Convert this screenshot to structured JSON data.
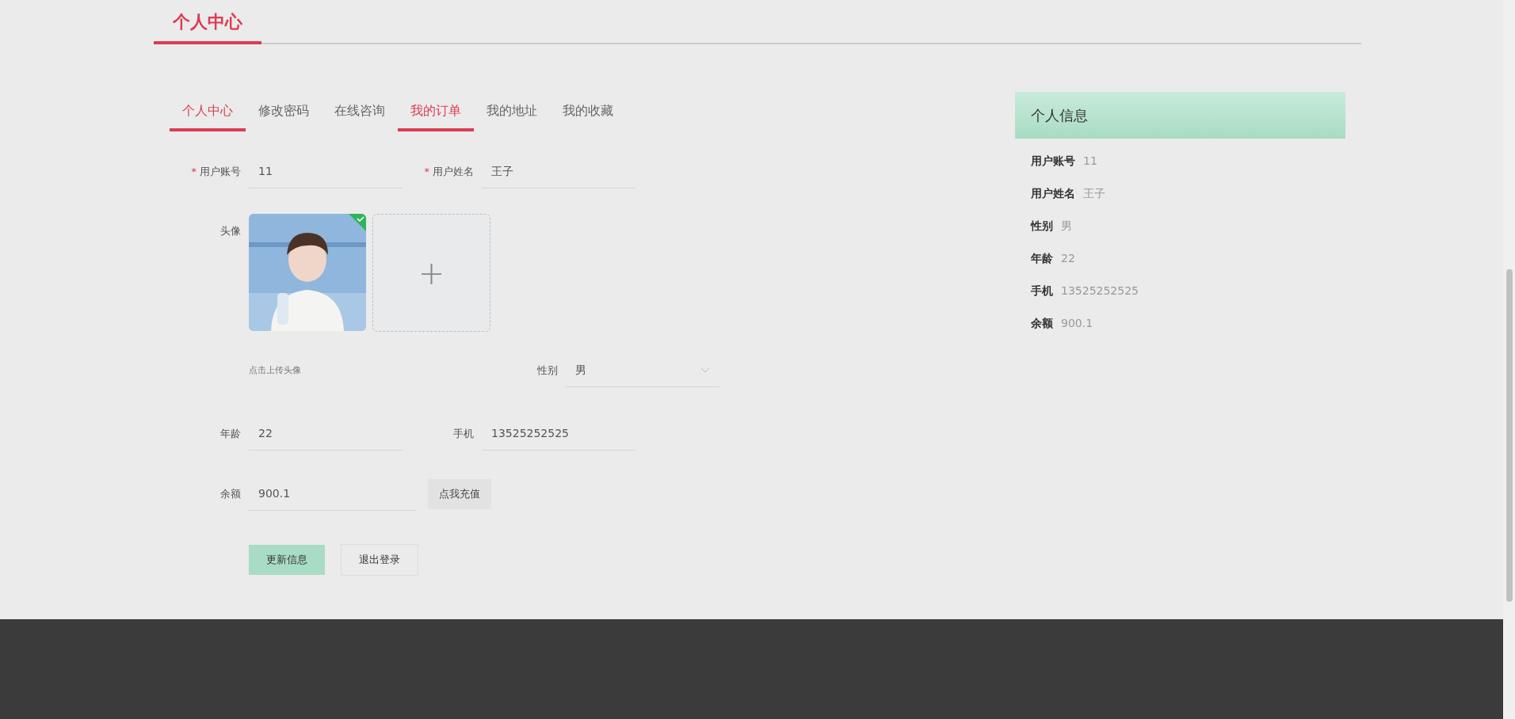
{
  "page_title": "个人中心",
  "tabs": [
    {
      "label": "个人中心",
      "selected": true
    },
    {
      "label": "修改密码",
      "selected": false
    },
    {
      "label": "在线咨询",
      "selected": false
    },
    {
      "label": "我的订单",
      "selected": true
    },
    {
      "label": "我的地址",
      "selected": false
    },
    {
      "label": "我的收藏",
      "selected": false
    }
  ],
  "form": {
    "account": {
      "label": "用户账号",
      "required_mark": "*",
      "value": "11"
    },
    "name": {
      "label": "用户姓名",
      "required_mark": "*",
      "value": "王子"
    },
    "avatar": {
      "label": "头像",
      "uploaded": true,
      "upload_icon": "+",
      "hint": "点击上传头像"
    },
    "gender": {
      "label": "性别",
      "value": "男"
    },
    "age": {
      "label": "年龄",
      "value": "22"
    },
    "phone": {
      "label": "手机",
      "value": "13525252525"
    },
    "balance": {
      "label": "余额",
      "value": "900.1",
      "recharge_button": "点我充值"
    },
    "buttons": [
      {
        "label": "更新信息",
        "kind": "primary"
      },
      {
        "label": "退出登录",
        "kind": "secondary"
      }
    ]
  },
  "info_panel": {
    "title": "个人信息",
    "rows": [
      {
        "label": "用户账号",
        "value": "11"
      },
      {
        "label": "用户姓名",
        "value": "王子"
      },
      {
        "label": "性别",
        "value": "男"
      },
      {
        "label": "年龄",
        "value": "22"
      },
      {
        "label": "手机",
        "value": "13525252525"
      },
      {
        "label": "余额",
        "value": "900.1"
      }
    ]
  }
}
